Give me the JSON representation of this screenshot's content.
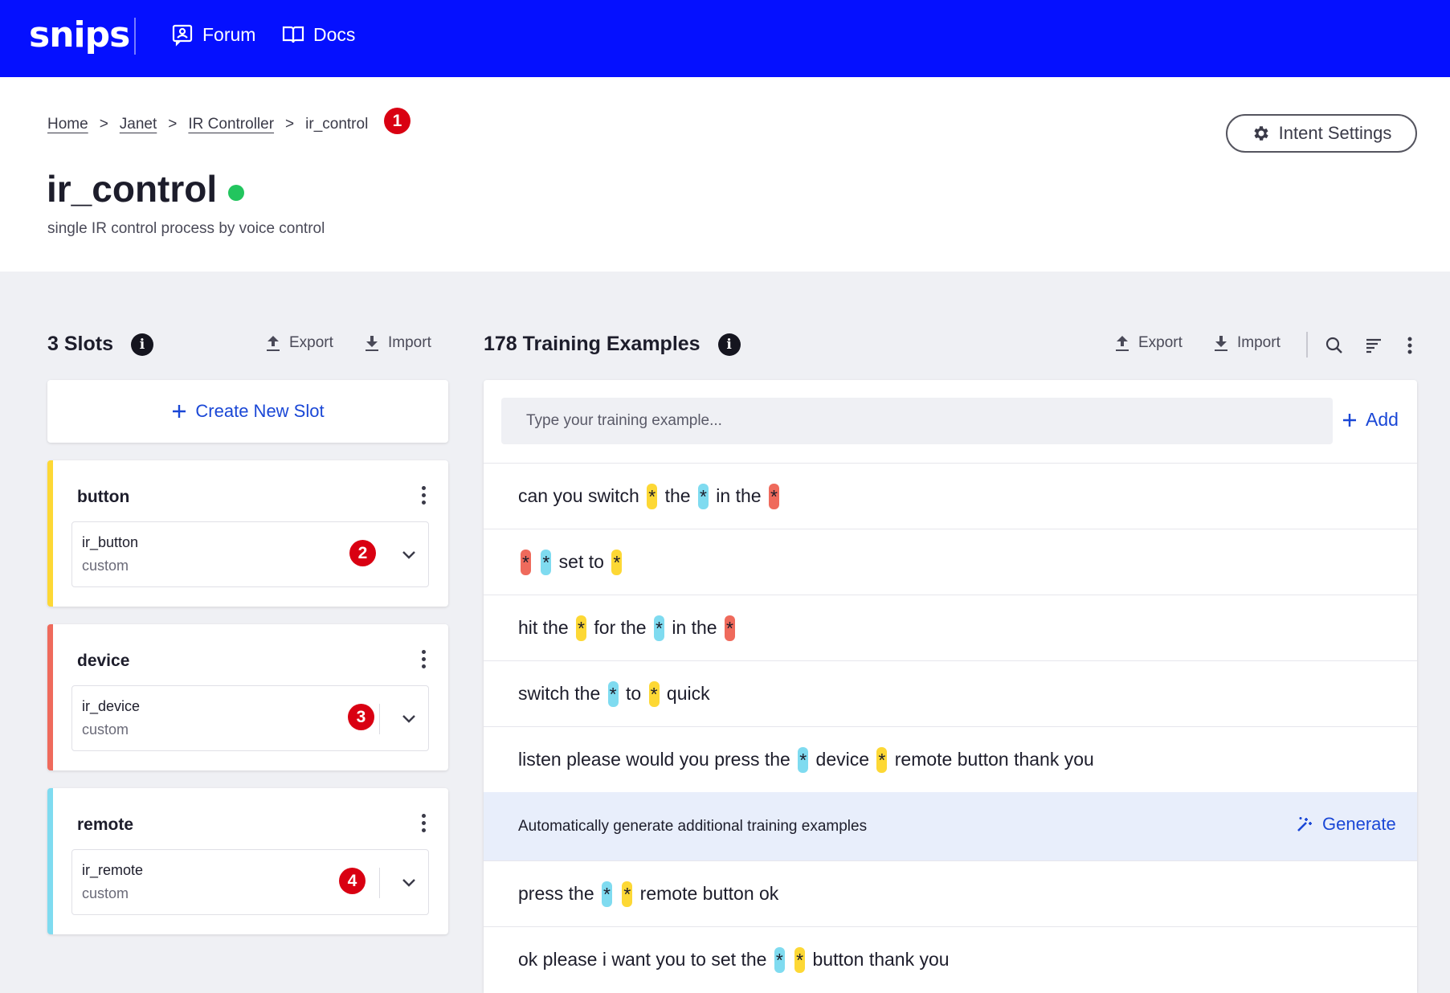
{
  "nav": {
    "logo": "snips",
    "forum": "Forum",
    "docs": "Docs"
  },
  "breadcrumb": {
    "home": "Home",
    "assistant": "Janet",
    "app": "IR Controller",
    "intent": "ir_control",
    "sep": ">",
    "badge": "1"
  },
  "header": {
    "title": "ir_control",
    "description": "single IR control process by voice control",
    "settings_label": "Intent Settings",
    "status_color": "#22c55e"
  },
  "slots": {
    "title": "3 Slots",
    "export_label": "Export",
    "import_label": "Import",
    "create_label": "Create New Slot",
    "items": [
      {
        "name": "button",
        "entity": "ir_button",
        "type": "custom",
        "badge": "2",
        "color": "#fdd835"
      },
      {
        "name": "device",
        "entity": "ir_device",
        "type": "custom",
        "badge": "3",
        "color": "#ef6a5c"
      },
      {
        "name": "remote",
        "entity": "ir_remote",
        "type": "custom",
        "badge": "4",
        "color": "#7fdbf0"
      }
    ]
  },
  "training": {
    "title": "178 Training Examples",
    "export_label": "Export",
    "import_label": "Import",
    "input_placeholder": "Type your training example...",
    "add_label": "Add",
    "generate_text": "Automatically generate additional training examples",
    "generate_label": "Generate",
    "examples": [
      "can you switch [*|y] the [*|b] in the [*|r]",
      "[*|r] [*|b] set to [*|y]",
      "hit the [*|y] for the [*|b] in the [*|r]",
      "switch the [*|b] to [*|y] quick",
      "listen please would you press the [*|b] device [*|y] remote button thank you",
      "press the [*|b] [*|y] remote button ok",
      "ok please i want you to set the [*|b] [*|y] button thank you"
    ]
  }
}
